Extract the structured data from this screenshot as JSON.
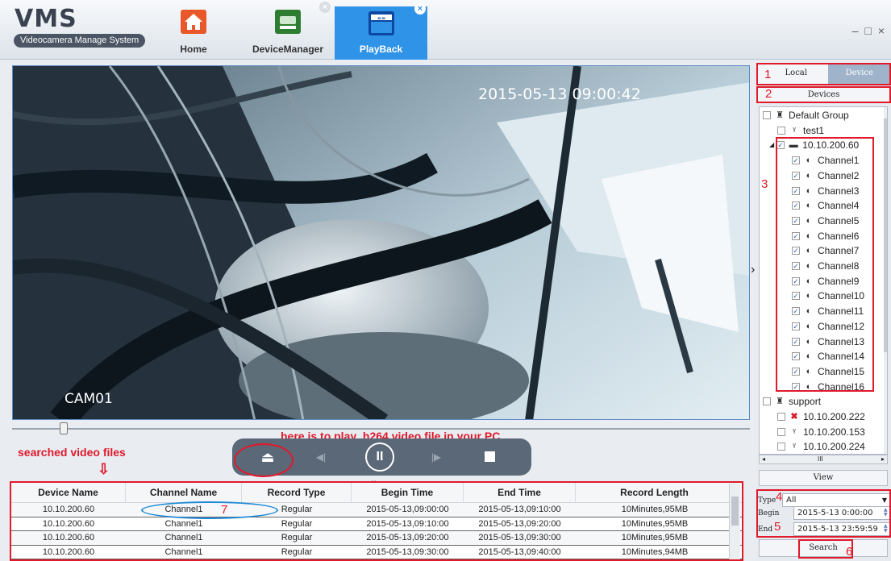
{
  "app": {
    "logo": "VMS",
    "subtitle": "Videocamera Manage System",
    "window_controls": "– □ ×"
  },
  "tabs": [
    {
      "label": "Home",
      "icon": "home-icon"
    },
    {
      "label": "DeviceManager",
      "icon": "device-manager-icon"
    },
    {
      "label": "PlayBack",
      "icon": "playback-icon",
      "active": true
    }
  ],
  "video": {
    "timestamp": "2015-05-13 09:00:42",
    "camera_label": "CAM01",
    "progress": 0.07
  },
  "annotations": {
    "searched": "searched video files",
    "searched_arrow": "⇩",
    "play_hint": "here is to play .h264 video file in your PC",
    "n1": "1",
    "n2": "2",
    "n3": "3",
    "n4": "4",
    "n5": "5",
    "n6": "6",
    "n7": "7"
  },
  "controls": {
    "eject": "⏏",
    "prev": "◀|",
    "pause": "II",
    "next": "|▶",
    "stop": ""
  },
  "table": {
    "headers": [
      "Device Name",
      "Channel Name",
      "Record Type",
      "Begin Time",
      "End Time",
      "Record Length"
    ],
    "rows": [
      [
        "10.10.200.60",
        "Channel1",
        "Regular",
        "2015-05-13,09:00:00",
        "2015-05-13,09:10:00",
        "10Minutes,95MB"
      ],
      [
        "10.10.200.60",
        "Channel1",
        "Regular",
        "2015-05-13,09:10:00",
        "2015-05-13,09:20:00",
        "10Minutes,95MB"
      ],
      [
        "10.10.200.60",
        "Channel1",
        "Regular",
        "2015-05-13,09:20:00",
        "2015-05-13,09:30:00",
        "10Minutes,95MB"
      ],
      [
        "10.10.200.60",
        "Channel1",
        "Regular",
        "2015-05-13,09:30:00",
        "2015-05-13,09:40:00",
        "10Minutes,94MB"
      ]
    ]
  },
  "panel": {
    "tab_local": "Local",
    "tab_device": "Device",
    "devices_header": "Devices",
    "tree": [
      {
        "label": "Default Group",
        "icon": "group-icon",
        "indent": 0,
        "checked": false
      },
      {
        "label": "test1",
        "icon": "device-icon",
        "indent": 1,
        "checked": false
      },
      {
        "label": "10.10.200.60",
        "icon": "camera-device-icon",
        "indent": 1,
        "checked": true,
        "expanded": true
      },
      {
        "label": "Channel1",
        "icon": "channel-icon",
        "indent": 2,
        "checked": true
      },
      {
        "label": "Channel2",
        "icon": "channel-icon",
        "indent": 2,
        "checked": true
      },
      {
        "label": "Channel3",
        "icon": "channel-icon",
        "indent": 2,
        "checked": true
      },
      {
        "label": "Channel4",
        "icon": "channel-icon",
        "indent": 2,
        "checked": true
      },
      {
        "label": "Channel5",
        "icon": "channel-icon",
        "indent": 2,
        "checked": true
      },
      {
        "label": "Channel6",
        "icon": "channel-icon",
        "indent": 2,
        "checked": true
      },
      {
        "label": "Channel7",
        "icon": "channel-icon",
        "indent": 2,
        "checked": true
      },
      {
        "label": "Channel8",
        "icon": "channel-icon",
        "indent": 2,
        "checked": true
      },
      {
        "label": "Channel9",
        "icon": "channel-icon",
        "indent": 2,
        "checked": true
      },
      {
        "label": "Channel10",
        "icon": "channel-icon",
        "indent": 2,
        "checked": true
      },
      {
        "label": "Channel11",
        "icon": "channel-icon",
        "indent": 2,
        "checked": true
      },
      {
        "label": "Channel12",
        "icon": "channel-icon",
        "indent": 2,
        "checked": true
      },
      {
        "label": "Channel13",
        "icon": "channel-icon",
        "indent": 2,
        "checked": true
      },
      {
        "label": "Channel14",
        "icon": "channel-icon",
        "indent": 2,
        "checked": true
      },
      {
        "label": "Channel15",
        "icon": "channel-icon",
        "indent": 2,
        "checked": true
      },
      {
        "label": "Channel16",
        "icon": "channel-icon",
        "indent": 2,
        "checked": true
      },
      {
        "label": "support",
        "icon": "group-icon",
        "indent": 0,
        "checked": false
      },
      {
        "label": "10.10.200.222",
        "icon": "offline-device-icon",
        "indent": 1,
        "checked": false
      },
      {
        "label": "10.10.200.153",
        "icon": "device-icon",
        "indent": 1,
        "checked": false
      },
      {
        "label": "10.10.200.224",
        "icon": "device-icon",
        "indent": 1,
        "checked": false
      }
    ],
    "hscroll_label": "III",
    "view_label": "View",
    "type_label": "Type",
    "type_value": "All",
    "begin_label": "Begin",
    "begin_value": "2015-5-13 0:00:00",
    "end_label": "End",
    "end_value": "2015-5-13 23:59:59",
    "search_label": "Search"
  },
  "colors": {
    "accent": "#2f93e8",
    "annotation": "#e0192b",
    "annotation_ellipse": "#1e8ad6"
  }
}
